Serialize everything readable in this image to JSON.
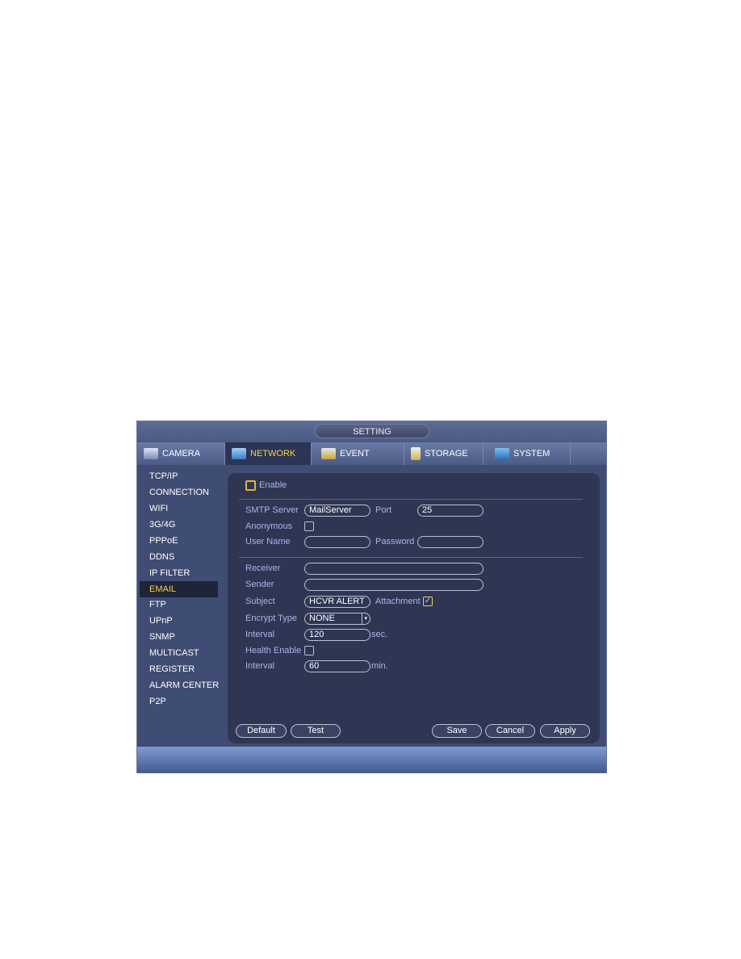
{
  "window": {
    "title": "SETTING"
  },
  "tabs": [
    {
      "label": "CAMERA",
      "icon": "camera-icon"
    },
    {
      "label": "NETWORK",
      "icon": "network-icon",
      "active": true
    },
    {
      "label": "EVENT",
      "icon": "event-icon"
    },
    {
      "label": "STORAGE",
      "icon": "storage-icon"
    },
    {
      "label": "SYSTEM",
      "icon": "system-icon"
    }
  ],
  "sidebar": {
    "items": [
      "TCP/IP",
      "CONNECTION",
      "WIFI",
      "3G/4G",
      "PPPoE",
      "DDNS",
      "IP FILTER",
      "EMAIL",
      "FTP",
      "UPnP",
      "SNMP",
      "MULTICAST",
      "REGISTER",
      "ALARM CENTER",
      "P2P"
    ],
    "selected": "EMAIL"
  },
  "form": {
    "enable": {
      "label": "Enable",
      "checked": false
    },
    "smtp_server": {
      "label": "SMTP Server",
      "value": "MailServer"
    },
    "port": {
      "label": "Port",
      "value": "25"
    },
    "anonymous": {
      "label": "Anonymous",
      "checked": false
    },
    "user_name": {
      "label": "User Name",
      "value": ""
    },
    "password": {
      "label": "Password",
      "value": ""
    },
    "receiver": {
      "label": "Receiver",
      "value": ""
    },
    "sender": {
      "label": "Sender",
      "value": ""
    },
    "subject": {
      "label": "Subject",
      "value": "HCVR ALERT"
    },
    "attachment": {
      "label": "Attachment",
      "checked": true
    },
    "encrypt_type": {
      "label": "Encrypt Type",
      "value": "NONE"
    },
    "interval": {
      "label": "Interval",
      "value": "120",
      "unit": "sec."
    },
    "health_enable": {
      "label": "Health Enable",
      "checked": false
    },
    "health_interval": {
      "label": "Interval",
      "value": "60",
      "unit": "min."
    }
  },
  "buttons": {
    "default": "Default",
    "test": "Test",
    "save": "Save",
    "cancel": "Cancel",
    "apply": "Apply"
  },
  "colors": {
    "active_tab_text": "#f3d347",
    "label": "#a7b6ee",
    "panel": "#2e3653"
  }
}
